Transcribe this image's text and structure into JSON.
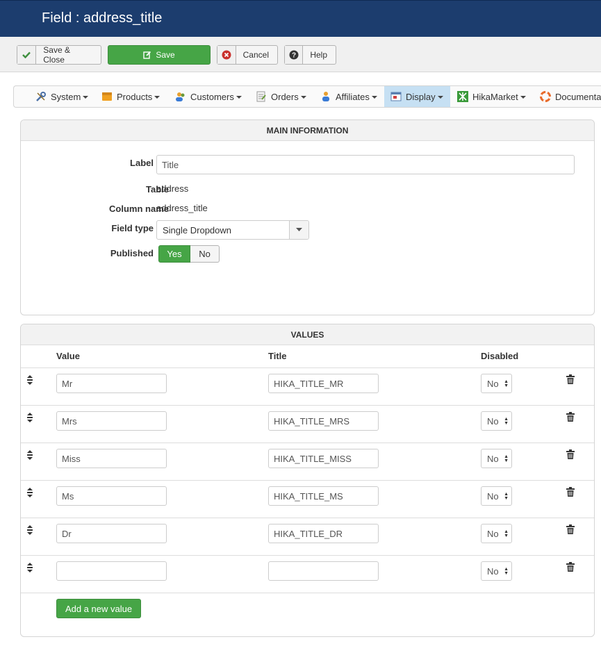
{
  "header": {
    "title": "Field : address_title"
  },
  "toolbar": {
    "save_close": "Save & Close",
    "save": "Save",
    "cancel": "Cancel",
    "help": "Help"
  },
  "menu": [
    {
      "label": "System",
      "icon": "wrench-icon"
    },
    {
      "label": "Products",
      "icon": "products-box-icon"
    },
    {
      "label": "Customers",
      "icon": "customers-icon"
    },
    {
      "label": "Orders",
      "icon": "orders-icon"
    },
    {
      "label": "Affiliates",
      "icon": "affiliates-icon"
    },
    {
      "label": "Display",
      "icon": "display-icon",
      "active": true
    },
    {
      "label": "HikaMarket",
      "icon": "hikamarket-icon"
    },
    {
      "label": "Documenta",
      "icon": "lifebuoy-icon"
    }
  ],
  "main": {
    "title": "MAIN INFORMATION",
    "label_label": "Label",
    "label_value": "Title",
    "table_label": "Table",
    "table_value": "address",
    "column_label": "Column name",
    "column_value": "address_title",
    "fieldtype_label": "Field type",
    "fieldtype_value": "Single Dropdown",
    "published_label": "Published",
    "published_yes": "Yes",
    "published_no": "No"
  },
  "values": {
    "title": "VALUES",
    "col_value": "Value",
    "col_title": "Title",
    "col_disabled": "Disabled",
    "rows": [
      {
        "value": "Mr",
        "title": "HIKA_TITLE_MR",
        "disabled": "No"
      },
      {
        "value": "Mrs",
        "title": "HIKA_TITLE_MRS",
        "disabled": "No"
      },
      {
        "value": "Miss",
        "title": "HIKA_TITLE_MISS",
        "disabled": "No"
      },
      {
        "value": "Ms",
        "title": "HIKA_TITLE_MS",
        "disabled": "No"
      },
      {
        "value": "Dr",
        "title": "HIKA_TITLE_DR",
        "disabled": "No"
      },
      {
        "value": "",
        "title": "",
        "disabled": "No"
      }
    ],
    "add_button": "Add a new value"
  },
  "colors": {
    "header_bg": "#1c3d6e",
    "green": "#46a546",
    "active_menu": "#c6e0f3"
  }
}
